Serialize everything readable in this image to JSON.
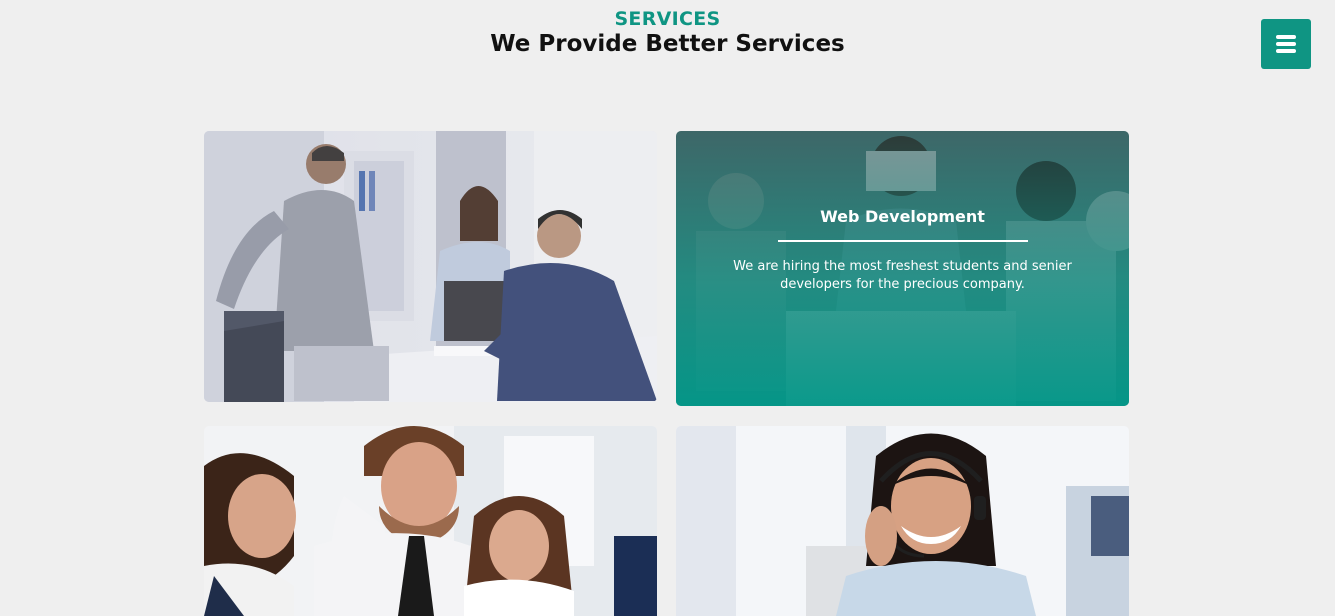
{
  "header": {
    "eyebrow": "SERVICES",
    "title": "We Provide Better Services"
  },
  "menu": {
    "icon": "hamburger-menu-icon",
    "color": "#0f9583"
  },
  "services": [
    {
      "name": "business-meeting-photo",
      "hover": false
    },
    {
      "name": "web-development-card",
      "hover": true,
      "title": "Web Development",
      "description": "We are hiring the most freshest students and senier developers for the precious company."
    },
    {
      "name": "team-at-computer-photo"
    },
    {
      "name": "customer-support-photo"
    }
  ],
  "colors": {
    "accent": "#0f9583",
    "background": "#efefef",
    "heading": "#111111"
  }
}
